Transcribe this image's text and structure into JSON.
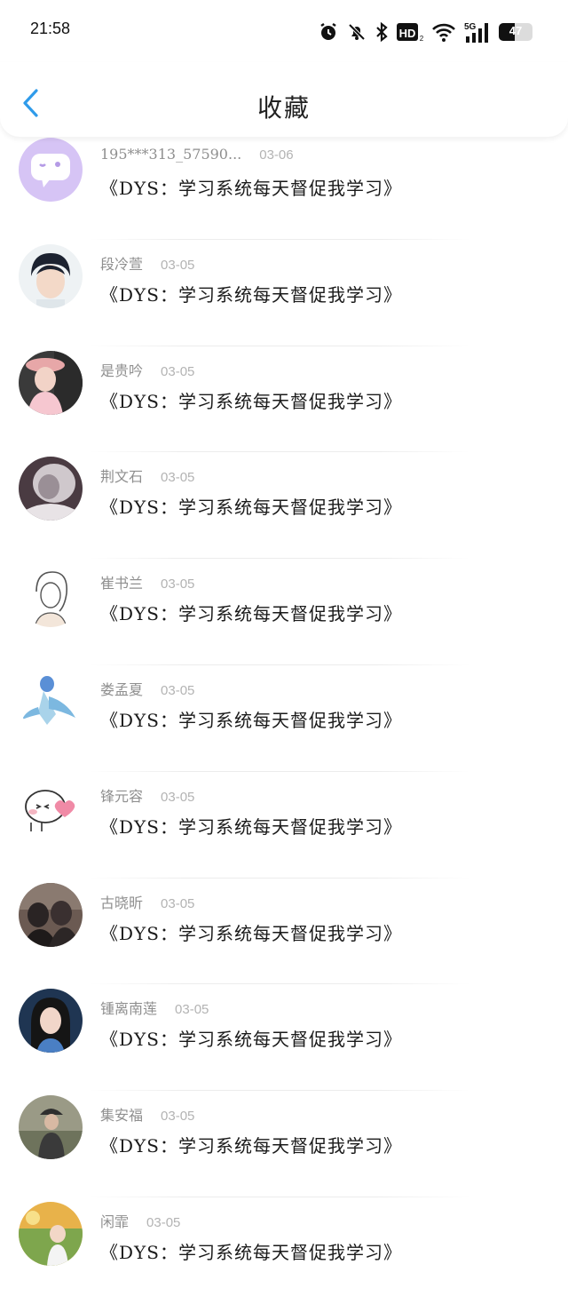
{
  "status_bar": {
    "time": "21:58",
    "icons": [
      "alarm-icon",
      "mute-icon",
      "bluetooth-icon",
      "hd-icon",
      "wifi-icon",
      "signal-5g-icon"
    ],
    "hd_label": "HD",
    "network_label": "5G",
    "battery_label": "47",
    "battery_level": 0.47
  },
  "header": {
    "title": "收藏",
    "back_icon": "chevron-left-icon",
    "accent_color": "#2f9bea"
  },
  "items": [
    {
      "name": "195***313_57590...",
      "date": "03-06",
      "title": "《DYS：学习系统每天督促我学习》",
      "avatar": "chat-bubble-avatar"
    },
    {
      "name": "段冷萱",
      "date": "03-05",
      "title": "《DYS：学习系统每天督促我学习》",
      "avatar": "photo-avatar"
    },
    {
      "name": "是贵吟",
      "date": "03-05",
      "title": "《DYS：学习系统每天督促我学习》",
      "avatar": "photo-avatar"
    },
    {
      "name": "荆文石",
      "date": "03-05",
      "title": "《DYS：学习系统每天督促我学习》",
      "avatar": "photo-avatar"
    },
    {
      "name": "崔书兰",
      "date": "03-05",
      "title": "《DYS：学习系统每天督促我学习》",
      "avatar": "sketch-avatar"
    },
    {
      "name": "娄孟夏",
      "date": "03-05",
      "title": "《DYS：学习系统每天督促我学习》",
      "avatar": "cartoon-avatar"
    },
    {
      "name": "锋元容",
      "date": "03-05",
      "title": "《DYS：学习系统每天督促我学习》",
      "avatar": "cartoon-avatar"
    },
    {
      "name": "古晓昕",
      "date": "03-05",
      "title": "《DYS：学习系统每天督促我学习》",
      "avatar": "photo-avatar"
    },
    {
      "name": "锺离南莲",
      "date": "03-05",
      "title": "《DYS：学习系统每天督促我学习》",
      "avatar": "photo-avatar"
    },
    {
      "name": "集安福",
      "date": "03-05",
      "title": "《DYS：学习系统每天督促我学习》",
      "avatar": "photo-avatar"
    },
    {
      "name": "闲霏",
      "date": "03-05",
      "title": "《DYS：学习系统每天督促我学习》",
      "avatar": "photo-avatar"
    }
  ]
}
